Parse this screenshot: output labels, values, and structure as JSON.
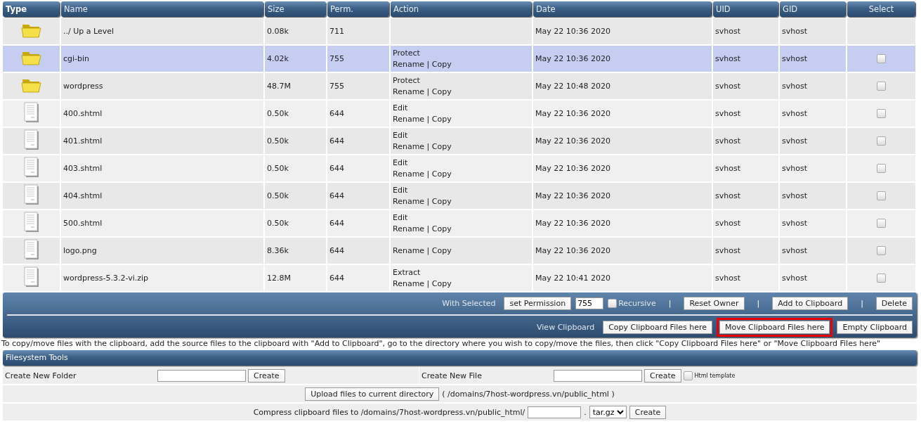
{
  "table": {
    "columns": [
      "Type",
      "Name",
      "Size",
      "Perm.",
      "Action",
      "Date",
      "UID",
      "GID",
      "Select"
    ],
    "rows": [
      {
        "kind": "folder",
        "name": "../ Up a Level",
        "size": "0.08k",
        "perm": "711",
        "actions": [],
        "date": "May 22 10:36 2020",
        "uid": "svhost",
        "gid": "svhost",
        "selected": false
      },
      {
        "kind": "folder",
        "name": "cgi-bin",
        "size": "4.02k",
        "perm": "755",
        "actions": [
          "Protect",
          "Rename | Copy"
        ],
        "date": "May 22 10:36 2020",
        "uid": "svhost",
        "gid": "svhost",
        "selected": true,
        "checked": false
      },
      {
        "kind": "folder",
        "name": "wordpress",
        "size": "48.7M",
        "perm": "755",
        "actions": [
          "Protect",
          "Rename | Copy"
        ],
        "date": "May 22 10:48 2020",
        "uid": "svhost",
        "gid": "svhost",
        "selected": false,
        "checked": false
      },
      {
        "kind": "file",
        "name": "400.shtml",
        "size": "0.50k",
        "perm": "644",
        "actions": [
          "Edit",
          "Rename | Copy"
        ],
        "date": "May 22 10:36 2020",
        "uid": "svhost",
        "gid": "svhost",
        "selected": false,
        "checked": false
      },
      {
        "kind": "file",
        "name": "401.shtml",
        "size": "0.50k",
        "perm": "644",
        "actions": [
          "Edit",
          "Rename | Copy"
        ],
        "date": "May 22 10:36 2020",
        "uid": "svhost",
        "gid": "svhost",
        "selected": false,
        "checked": false
      },
      {
        "kind": "file",
        "name": "403.shtml",
        "size": "0.50k",
        "perm": "644",
        "actions": [
          "Edit",
          "Rename | Copy"
        ],
        "date": "May 22 10:36 2020",
        "uid": "svhost",
        "gid": "svhost",
        "selected": false,
        "checked": false
      },
      {
        "kind": "file",
        "name": "404.shtml",
        "size": "0.50k",
        "perm": "644",
        "actions": [
          "Edit",
          "Rename | Copy"
        ],
        "date": "May 22 10:36 2020",
        "uid": "svhost",
        "gid": "svhost",
        "selected": false,
        "checked": false
      },
      {
        "kind": "file",
        "name": "500.shtml",
        "size": "0.50k",
        "perm": "644",
        "actions": [
          "Edit",
          "Rename | Copy"
        ],
        "date": "May 22 10:36 2020",
        "uid": "svhost",
        "gid": "svhost",
        "selected": false,
        "checked": false
      },
      {
        "kind": "file",
        "name": "logo.png",
        "size": "8.36k",
        "perm": "644",
        "actions": [
          "Rename | Copy"
        ],
        "date": "May 22 10:36 2020",
        "uid": "svhost",
        "gid": "svhost",
        "selected": false,
        "checked": false
      },
      {
        "kind": "file",
        "name": "wordpress-5.3.2-vi.zip",
        "size": "12.8M",
        "perm": "644",
        "actions": [
          "Extract",
          "Rename | Copy"
        ],
        "date": "May 22 10:41 2020",
        "uid": "svhost",
        "gid": "svhost",
        "selected": false,
        "checked": false
      }
    ]
  },
  "with_selected": {
    "label": "With Selected",
    "items": [
      {
        "kind": "button",
        "text": "set Permission"
      },
      {
        "kind": "input",
        "value": "755"
      },
      {
        "kind": "checkbox",
        "text": "Recursive",
        "checked": false
      },
      {
        "kind": "separator",
        "text": "|"
      },
      {
        "kind": "button",
        "text": "Reset Owner"
      },
      {
        "kind": "separator",
        "text": "|"
      },
      {
        "kind": "button",
        "text": "Add to Clipboard"
      },
      {
        "kind": "separator",
        "text": "|"
      },
      {
        "kind": "button",
        "text": "Delete"
      }
    ]
  },
  "clipboard": {
    "label": "View Clipboard",
    "buttons": [
      {
        "text": "Copy Clipboard Files here",
        "highlighted": false
      },
      {
        "text": "Move Clipboard Files here",
        "highlighted": true
      },
      {
        "text": "Empty Clipboard",
        "highlighted": false
      }
    ]
  },
  "note": "To copy/move files with the clipboard, add the source files to the clipboard with \"Add to Clipboard\", go to the directory where you wish to copy/move the files, then click \"Copy Clipboard Files here\" or \"Move Clipboard Files here\"",
  "filesystem_tools": {
    "title": "Filesystem Tools",
    "create_folder": {
      "label": "Create New Folder",
      "button": "Create"
    },
    "create_file": {
      "label": "Create New File",
      "button": "Create",
      "template_label": "Html template",
      "template_checked": false
    },
    "upload": {
      "button": "Upload files to current directory",
      "path": "( /domains/7host-wordpress.vn/public_html )"
    },
    "compress": {
      "label": "Compress clipboard files to /domains/7host-wordpress.vn/public_html/",
      "dot": ".",
      "format": "tar.gz",
      "button": "Create"
    }
  }
}
